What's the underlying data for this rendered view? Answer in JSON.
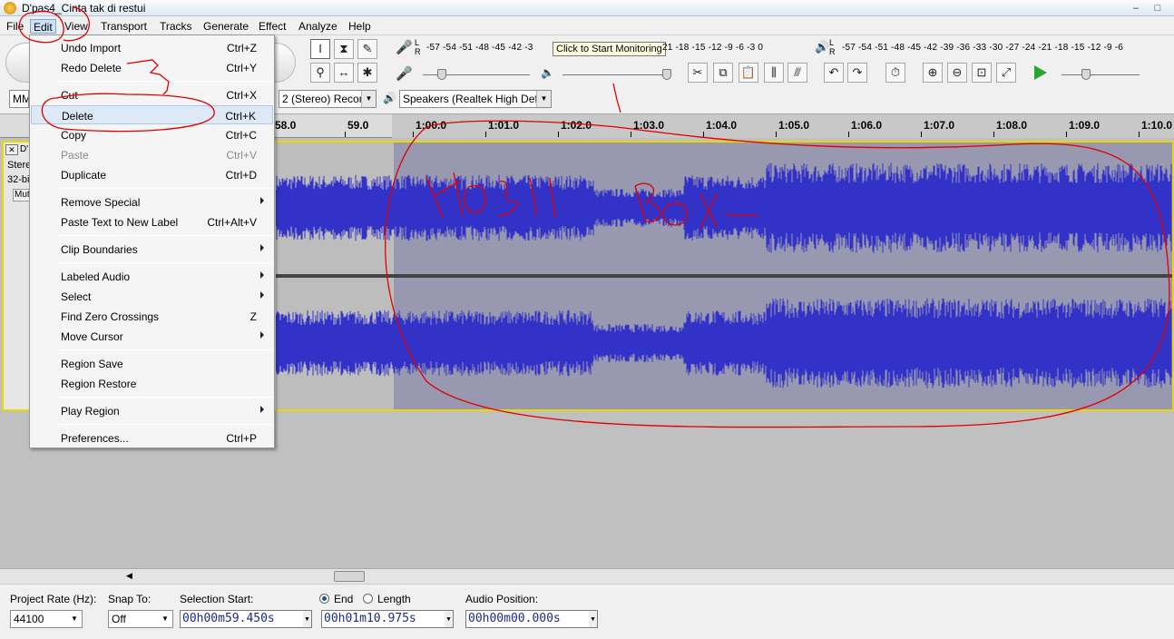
{
  "window": {
    "title": "D'pas4_Cinta tak di restui",
    "min": "–",
    "max": "□",
    "close": "✕"
  },
  "menubar": [
    "File",
    "Edit",
    "View",
    "Transport",
    "Tracks",
    "Generate",
    "Effect",
    "Analyze",
    "Help"
  ],
  "edit_menu": [
    {
      "label": "Undo Import",
      "shortcut": "Ctrl+Z"
    },
    {
      "label": "Redo Delete",
      "shortcut": "Ctrl+Y"
    },
    {
      "label": "Cut",
      "shortcut": "Ctrl+X"
    },
    {
      "label": "Delete",
      "shortcut": "Ctrl+K"
    },
    {
      "label": "Copy",
      "shortcut": "Ctrl+C"
    },
    {
      "label": "Paste",
      "shortcut": "Ctrl+V"
    },
    {
      "label": "Duplicate",
      "shortcut": "Ctrl+D"
    },
    {
      "label": "Remove Special",
      "shortcut": ""
    },
    {
      "label": "Paste Text to New Label",
      "shortcut": "Ctrl+Alt+V"
    },
    {
      "label": "Clip Boundaries",
      "shortcut": ""
    },
    {
      "label": "Labeled Audio",
      "shortcut": ""
    },
    {
      "label": "Select",
      "shortcut": ""
    },
    {
      "label": "Find Zero Crossings",
      "shortcut": "Z"
    },
    {
      "label": "Move Cursor",
      "shortcut": ""
    },
    {
      "label": "Region Save",
      "shortcut": ""
    },
    {
      "label": "Region Restore",
      "shortcut": ""
    },
    {
      "label": "Play Region",
      "shortcut": ""
    },
    {
      "label": "Preferences...",
      "shortcut": "Ctrl+P"
    }
  ],
  "meters": {
    "record_channels": "L R",
    "play_channels": "L R",
    "record_scale": "-57 -54 -51 -48 -45 -42 -3",
    "record_scale_tail": "21 -18 -15 -12  -9  -6  -3  0",
    "play_scale": "-57 -54 -51 -48 -45 -42 -39 -36 -33 -30 -27 -24 -21 -18 -15 -12  -9  -6",
    "monitor_tooltip": "Click to Start Monitoring"
  },
  "devices": {
    "host": "MM",
    "channels": "2 (Stereo) Recor",
    "output": "Speakers (Realtek High Defi"
  },
  "timeline": [
    "58.0",
    "59.0",
    "1:00.0",
    "1:01.0",
    "1:02.0",
    "1:03.0",
    "1:04.0",
    "1:05.0",
    "1:06.0",
    "1:07.0",
    "1:08.0",
    "1:09.0",
    "1:10.0"
  ],
  "track": {
    "name": "D'",
    "type": "Stere",
    "format": "32-bi",
    "mute": "Mut",
    "close": "✕"
  },
  "selection_bar": {
    "project_rate_label": "Project Rate (Hz):",
    "project_rate": "44100",
    "snap_label": "Snap To:",
    "snap_value": "Off",
    "selection_start_label": "Selection Start:",
    "end_label": "End",
    "length_label": "Length",
    "selection_start": "00h00m59.450s",
    "selection_end": "00h01m10.975s",
    "audio_position_label": "Audio Position:",
    "audio_position": "00h00m00.000s"
  },
  "colors": {
    "waveform": "#3232c8",
    "selection_bg": "#9898b0",
    "unselected_bg": "#bdbdbd",
    "annotation": "#e00000"
  }
}
